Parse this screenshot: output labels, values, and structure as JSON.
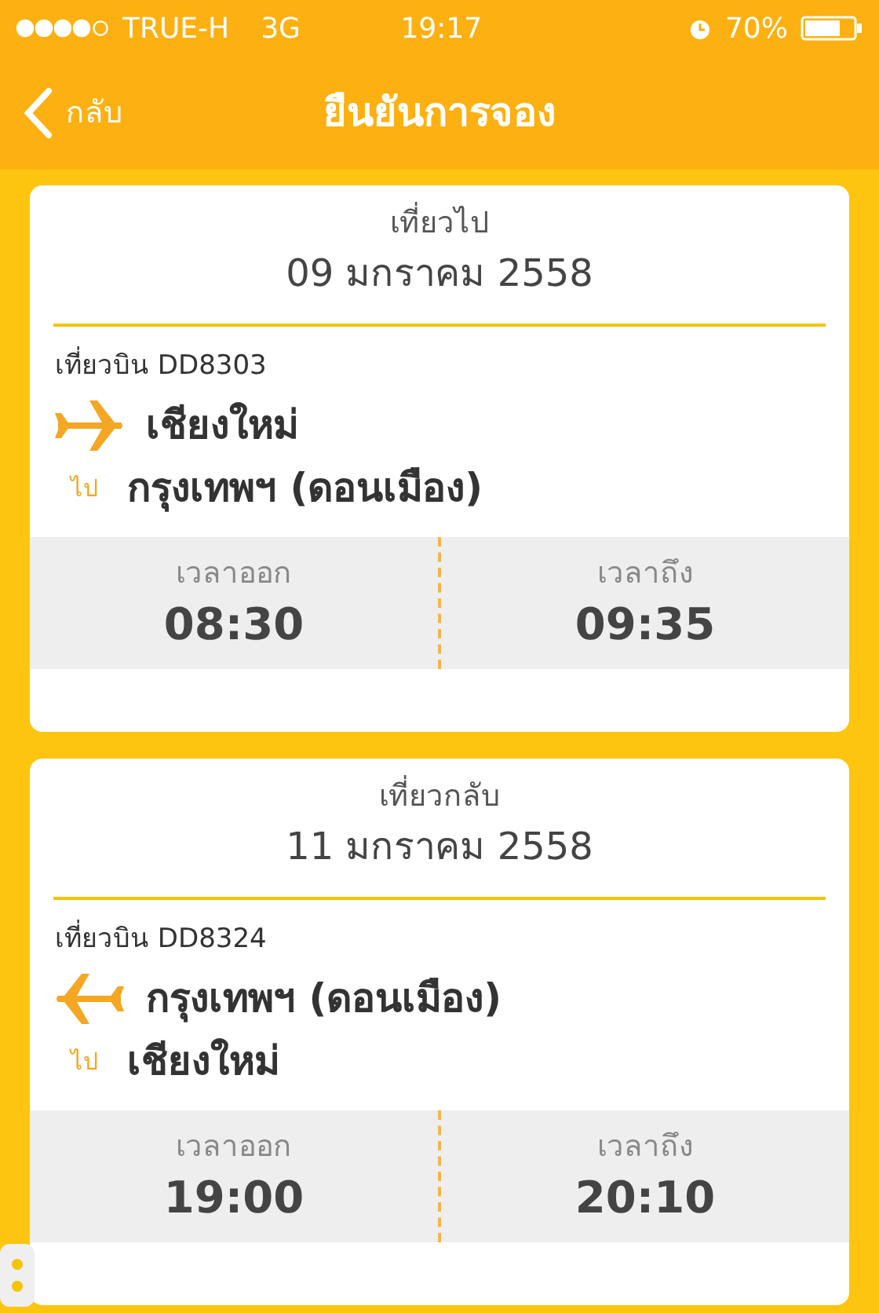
{
  "status_bar": {
    "carrier": "TRUE-H",
    "network": "3G",
    "time": "19:17",
    "battery": "70%"
  },
  "nav": {
    "back": "กลับ",
    "title": "ยืนยันการจอง"
  },
  "flights": [
    {
      "kind": "outbound",
      "heading": "เที่ยวไป",
      "date": "09 มกราคม 2558",
      "flight_no": "เที่ยวบิน DD8303",
      "from": "เชียงใหม่",
      "to_label": "ไป",
      "to": "กรุงเทพฯ (ดอนเมือง)",
      "depart_label": "เวลาออก",
      "depart": "08:30",
      "arrive_label": "เวลาถึง",
      "arrive": "09:35"
    },
    {
      "kind": "return",
      "heading": "เที่ยวกลับ",
      "date": "11 มกราคม 2558",
      "flight_no": "เที่ยวบิน DD8324",
      "from": "กรุงเทพฯ (ดอนเมือง)",
      "to_label": "ไป",
      "to": "เชียงใหม่",
      "depart_label": "เวลาออก",
      "depart": "19:00",
      "arrive_label": "เวลาถึง",
      "arrive": "20:10"
    }
  ]
}
